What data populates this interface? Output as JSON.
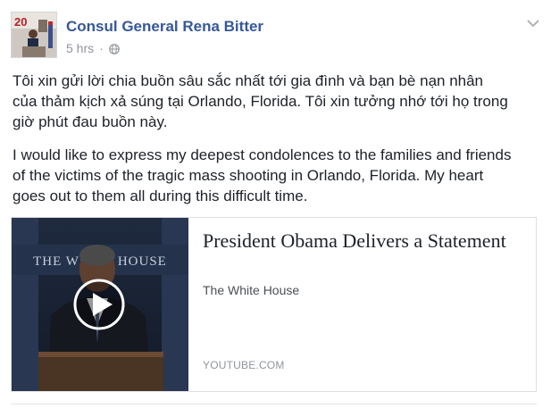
{
  "post": {
    "author": "Consul General Rena Bitter",
    "timestamp": "5 hrs",
    "separator": "·",
    "privacy_icon": "globe-icon",
    "menu_icon": "chevron-down-icon",
    "text_vi": "Tôi xin gửi lời chia buồn sâu sắc nhất tới gia đình và bạn bè nạn nhân\ncủa thảm kịch xả súng tại Orlando, Florida. Tôi xin tưởng nhớ tới họ trong\ngiờ phút đau buồn này.",
    "text_en": "I would like to express my deepest condolences to the families and friends\nof the victims of the tragic mass shooting in Orlando, Florida. My heart\ngoes out to them all during this difficult time."
  },
  "link_card": {
    "title": "President Obama Delivers a Statement",
    "source": "The White House",
    "domain": "YOUTUBE.COM",
    "thumbnail_sign_text": "THE WHITE HOUSE",
    "play_icon": "play-icon"
  },
  "colors": {
    "author_link": "#365899",
    "body_text": "#1d2129",
    "meta_text": "#90949c",
    "card_border": "#dddfe2"
  }
}
